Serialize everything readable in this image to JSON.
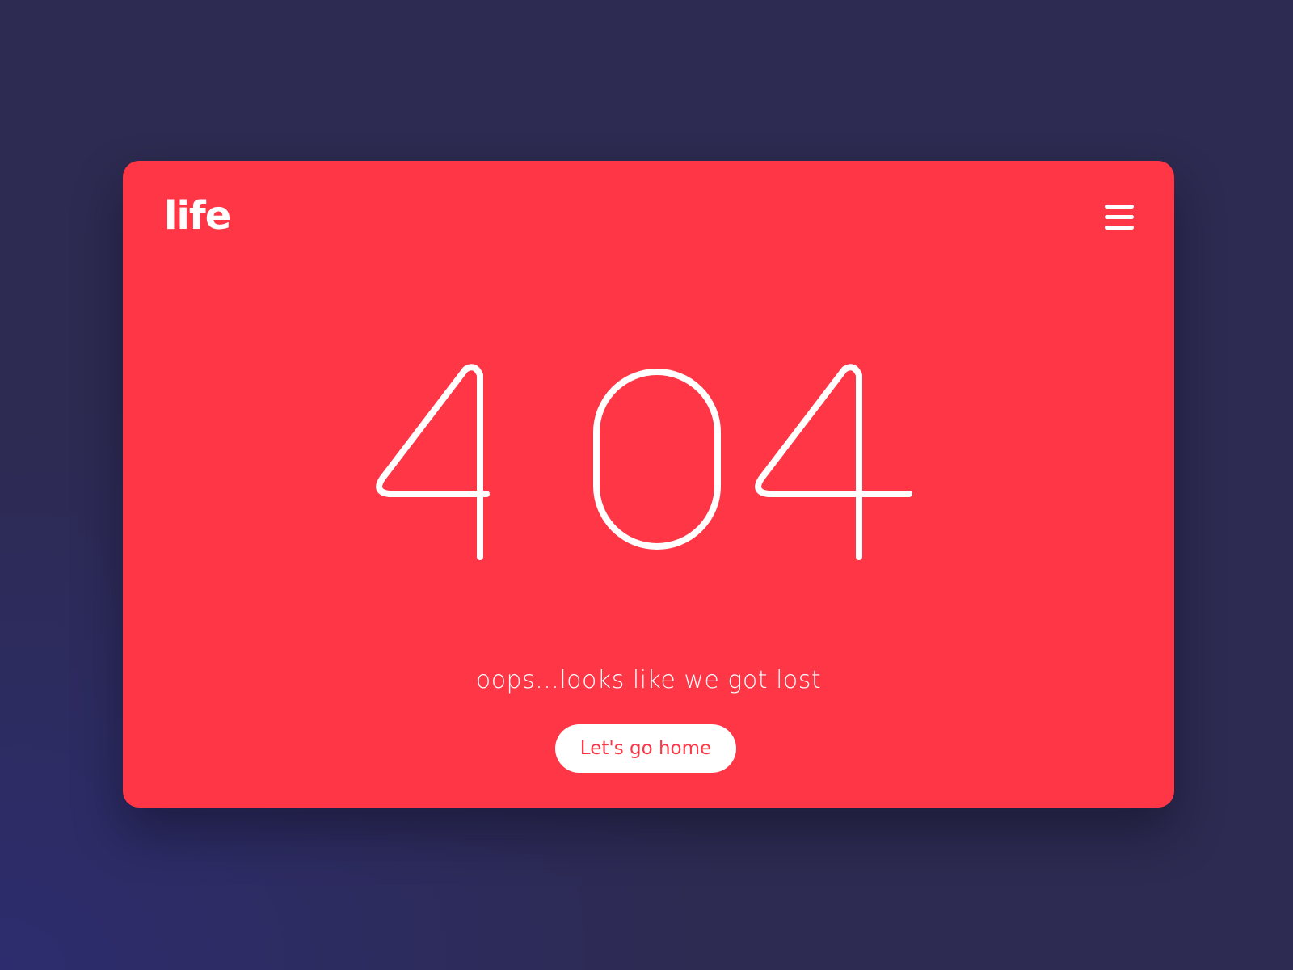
{
  "header": {
    "logo_text": "life",
    "menu_icon": "hamburger-menu-icon"
  },
  "error": {
    "code": "404",
    "message": "oops...looks like we got lost",
    "home_button_label": "Let's go home"
  },
  "colors": {
    "background": "#2d2b51",
    "card": "#ff3646",
    "text": "#ffffff",
    "button_text": "#ff3646"
  }
}
